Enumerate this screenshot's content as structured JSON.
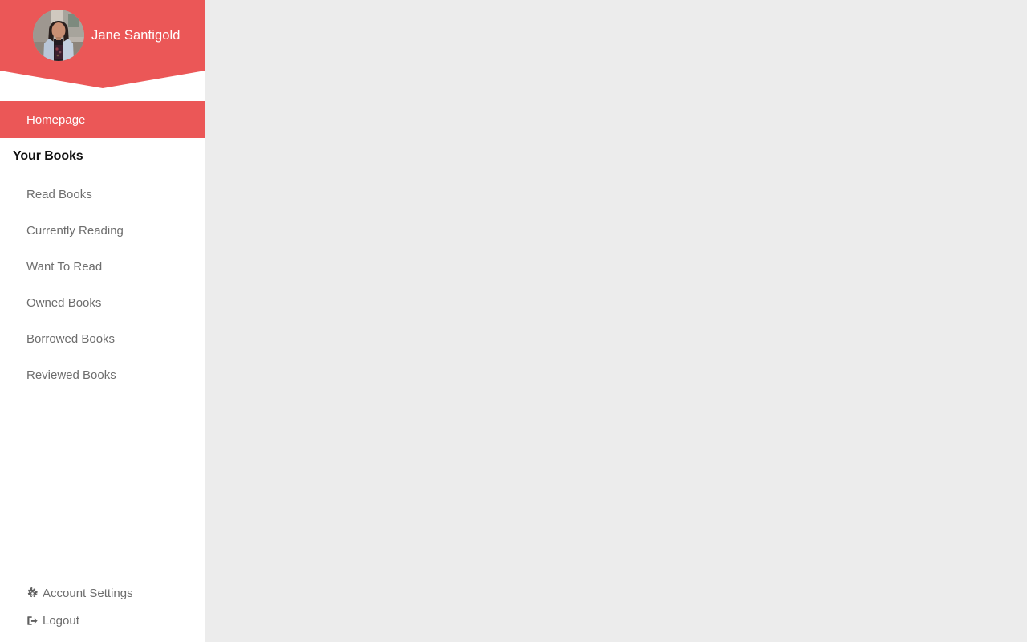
{
  "theme": {
    "accent": "#eb5757",
    "sidebar_bg": "#ffffff",
    "content_bg": "#ececec",
    "muted_text": "#6d6d6d",
    "heading_text": "#111111",
    "on_accent_text": "#ffffff"
  },
  "sidebar": {
    "profile": {
      "name": "Jane Santigold",
      "avatar_icon": "user-avatar-photo"
    },
    "primary_nav": {
      "label": "Homepage",
      "active": true
    },
    "section": {
      "title": "Your Books",
      "items": [
        {
          "label": "Read Books"
        },
        {
          "label": "Currently Reading"
        },
        {
          "label": "Want To Read"
        },
        {
          "label": "Owned Books"
        },
        {
          "label": "Borrowed Books"
        },
        {
          "label": "Reviewed Books"
        }
      ]
    },
    "bottom_links": [
      {
        "label": "Account Settings",
        "icon": "gear-icon"
      },
      {
        "label": "Logout",
        "icon": "sign-out-icon"
      }
    ]
  },
  "main": {
    "content": ""
  }
}
